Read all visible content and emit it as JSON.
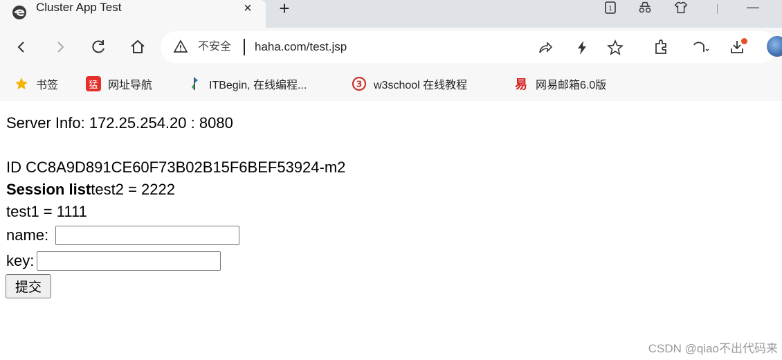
{
  "browser": {
    "tab": {
      "title": "Cluster App Test",
      "close_glyph": "×",
      "favicon": "edge-icon"
    },
    "new_tab_glyph": "+",
    "window_controls": {
      "minimize_glyph": "—"
    },
    "nav": {
      "back": "‹",
      "forward": "›",
      "reload": "C",
      "home": "⌂"
    },
    "address": {
      "security_label": "不安全",
      "url": "haha.com/test.jsp"
    },
    "bookmarks": [
      {
        "label": "书签",
        "icon": "star-icon"
      },
      {
        "label": "网址导航",
        "icon": "nav-site-icon"
      },
      {
        "label": "ITBegin, 在线编程...",
        "icon": "itbegin-icon"
      },
      {
        "label": "w3school 在线教程",
        "icon": "w3school-icon"
      },
      {
        "label": "网易邮箱6.0版",
        "icon": "netease-mail-icon"
      }
    ]
  },
  "page": {
    "server_info": "Server Info: 172.25.254.20 : 8080",
    "session_id": "ID CC8A9D891CE60F73B02B15F6BEF53924-m2",
    "session_list_label": "Session list",
    "session_items": [
      "test2 = 2222",
      "test1 = 1111"
    ],
    "form": {
      "name_label": "name:",
      "name_value": "",
      "key_label": "key:",
      "key_value": "",
      "submit_label": "提交"
    }
  },
  "watermark": "CSDN @qiao不出代码来",
  "colors": {
    "chrome_bg": "#f7f7f7",
    "tabbar_bg": "#dfe3e8",
    "download_badge": "#e4522b"
  }
}
